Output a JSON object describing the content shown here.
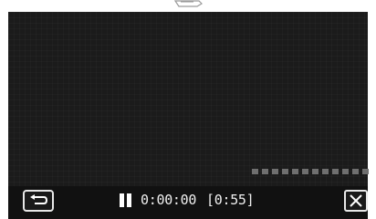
{
  "player": {
    "state": "paused",
    "time_current": "0:00:00",
    "time_remaining": "[0:55]",
    "pause_icon": "pause-icon",
    "back_icon": "return-arrow-icon",
    "close_icon": "close-x-icon",
    "progress_segments": 12
  },
  "colors": {
    "screen": "#1b1b1b",
    "controlbar": "#111111",
    "text": "#f0f0f0",
    "progress": "#6f6f6f"
  }
}
